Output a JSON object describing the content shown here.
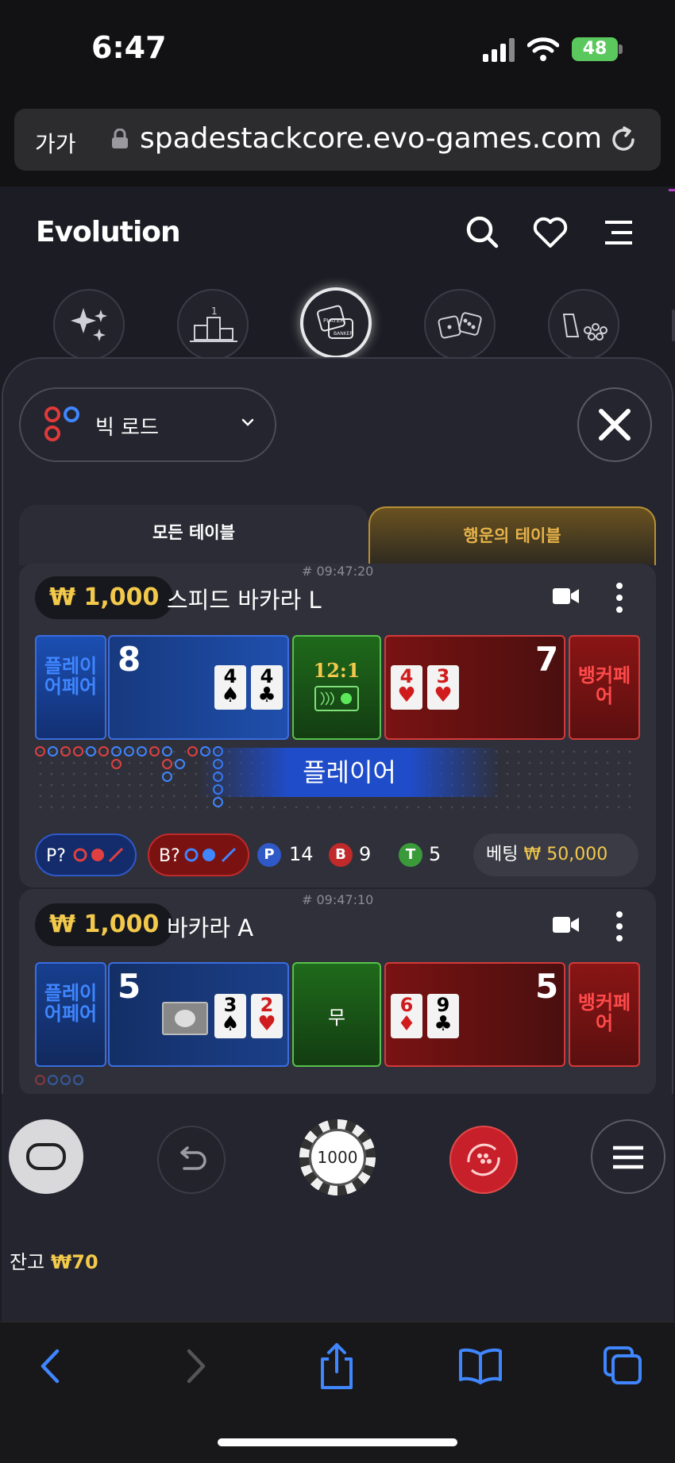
{
  "status": {
    "time": "6:47",
    "battery": "48"
  },
  "browser": {
    "aa": "가가",
    "url": "spadestackcore.evo-games.com"
  },
  "app": {
    "brand": "Evolution"
  },
  "road_selector": {
    "label": "빅 로드"
  },
  "tabs": {
    "all": "모든 테이블",
    "lucky": "행운의 테이블"
  },
  "tables": [
    {
      "timestamp": "# 09:47:20",
      "min_bet": "₩ 1,000",
      "name": "스피드 바카라 L",
      "player_pair": "플레이어페어",
      "player_score": "8",
      "player_cards": [
        {
          "rank": "4",
          "suit": "♠"
        },
        {
          "rank": "4",
          "suit": "♣"
        }
      ],
      "tie_label": "12:1",
      "banker_score": "7",
      "banker_cards": [
        {
          "rank": "4",
          "suit": "♥"
        },
        {
          "rank": "3",
          "suit": "♥"
        }
      ],
      "banker_pair": "뱅커페어",
      "result_banner": "플레이어",
      "ask_p": "P?",
      "ask_b": "B?",
      "stat_p_label": "P",
      "stat_p": "14",
      "stat_b_label": "B",
      "stat_b": "9",
      "stat_t_label": "T",
      "stat_t": "5",
      "bet_label": "베팅",
      "bet_amount": "₩ 50,000"
    },
    {
      "timestamp": "# 09:47:10",
      "min_bet": "₩ 1,000",
      "name": "바카라 A",
      "player_pair": "플레이어페어",
      "player_score": "5",
      "player_cards": [
        {
          "rank": "3",
          "suit": "♠"
        },
        {
          "rank": "2",
          "suit": "♥"
        }
      ],
      "tie_label": "무",
      "banker_score": "5",
      "banker_cards": [
        {
          "rank": "6",
          "suit": "♦"
        },
        {
          "rank": "9",
          "suit": "♣"
        }
      ],
      "banker_pair": "뱅커페어"
    }
  ],
  "chip": {
    "value": "1000"
  },
  "balance": {
    "label": "잔고",
    "amount": "₩70"
  },
  "colors": {
    "gold": "#f3c94b",
    "player_blue": "#3a6ddf",
    "banker_red": "#d23a3a",
    "tie_green": "#57c14b"
  }
}
